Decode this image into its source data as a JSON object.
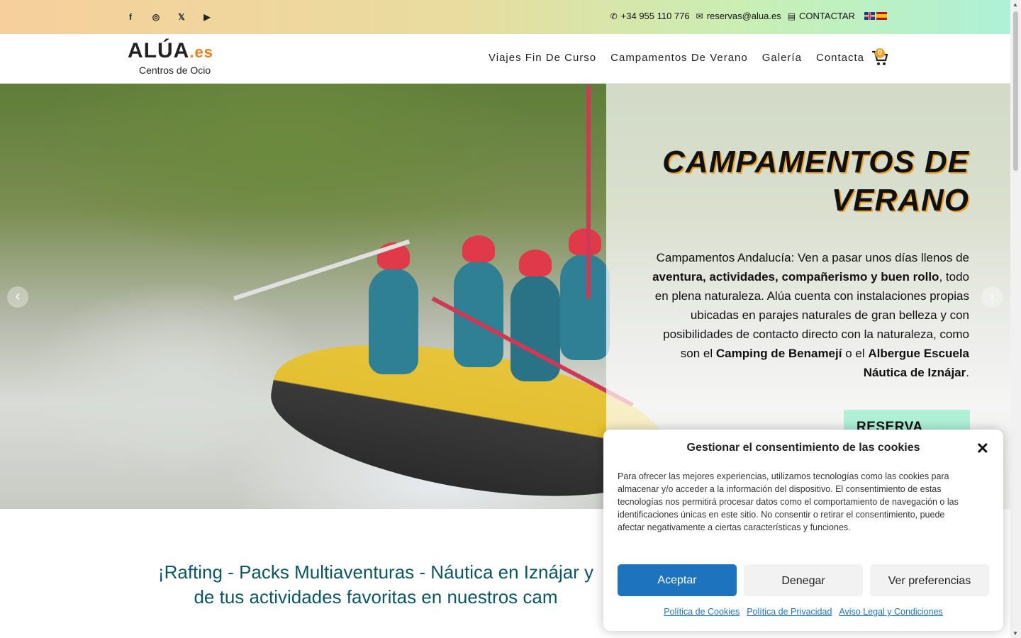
{
  "topbar": {
    "social": [
      {
        "name": "facebook",
        "glyph": "f"
      },
      {
        "name": "instagram",
        "glyph": "◎"
      },
      {
        "name": "x-twitter",
        "glyph": "𝕏"
      },
      {
        "name": "youtube",
        "glyph": "▶"
      }
    ],
    "phone": "+34 955 110 776",
    "email": "reservas@alua.es",
    "contact_label": "CONTACTAR"
  },
  "header": {
    "logo_main": "ALÚA",
    "logo_suffix": ".es",
    "logo_sub": "Centros de Ocio",
    "nav": [
      "Viajes Fin De Curso",
      "Campamentos De Verano",
      "Galería",
      "Contacta"
    ],
    "cart_count": "0"
  },
  "hero": {
    "title": "CAMPAMENTOS DE VERANO",
    "text_parts": [
      "Campamentos Andalucía: Ven a pasar unos días llenos de ",
      "aventura, actividades, compañerismo y buen rollo",
      ", todo en plena naturaleza. Alúa cuenta con instalaciones propias ubicadas en parajes naturales de gran belleza y con posibilidades de contacto directo con la naturaleza, como son el ",
      "Camping de Benamejí",
      " o el ",
      "Albergue Escuela Náutica de Iznájar",
      "."
    ],
    "cta": "RESERVA AQUÍ",
    "prev_arrow": "‹",
    "next_arrow": "›"
  },
  "headline": {
    "line1": "¡Rafting - Packs Multiaventuras - Náutica en Iznájar y",
    "line2": "de tus actividades favoritas en nuestros cam"
  },
  "cookie": {
    "title": "Gestionar el consentimiento de las cookies",
    "close": "✕",
    "text": "Para ofrecer las mejores experiencias, utilizamos tecnologías como las cookies para almacenar y/o acceder a la información del dispositivo. El consentimiento de estas tecnologías nos permitirá procesar datos como el comportamiento de navegación o las identificaciones únicas en este sitio. No consentir o retirar el consentimiento, puede afectar negativamente a ciertas características y funciones.",
    "accept": "Aceptar",
    "deny": "Denegar",
    "prefs": "Ver preferencias",
    "links": [
      "Política de Cookies",
      "Política de Privacidad",
      "Aviso Legal y Condiciones"
    ]
  },
  "colors": {
    "accent_orange": "#f2a325",
    "cta_mint": "#aef1d7",
    "headline_teal": "#0c5660",
    "button_blue": "#1e73be"
  }
}
